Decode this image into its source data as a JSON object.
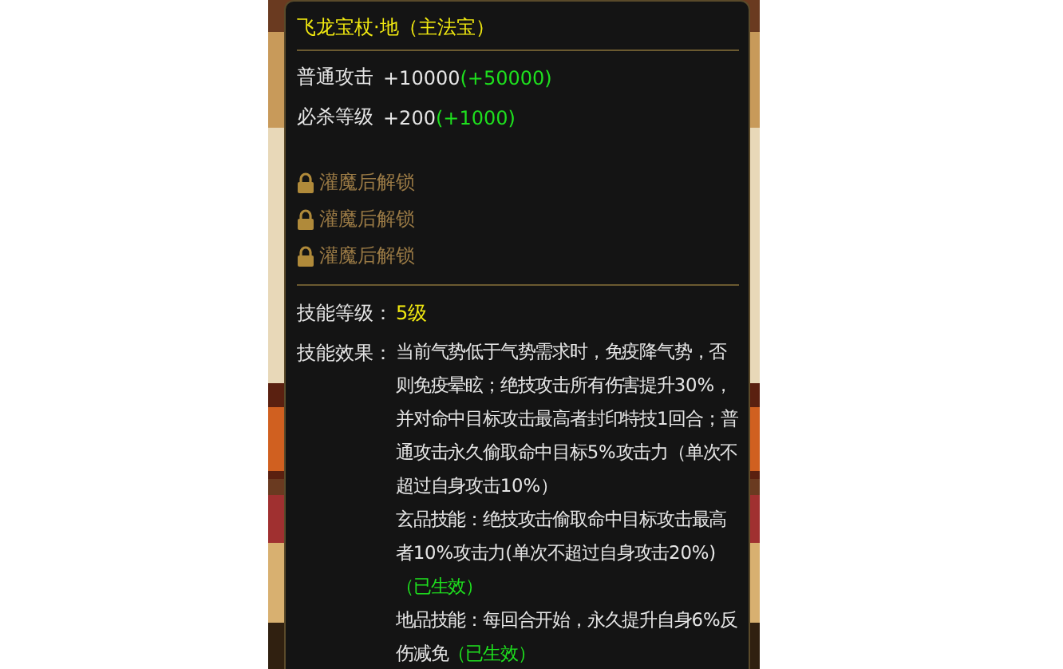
{
  "tooltip": {
    "title": "飞龙宝杖·地（主法宝）",
    "stats": [
      {
        "label": "普通攻击",
        "value": "+10000",
        "bonus": "(+50000)"
      },
      {
        "label": "必杀等级",
        "value": "+200",
        "bonus": "(+1000)"
      }
    ],
    "locked_slots": [
      {
        "text": "灌魔后解锁"
      },
      {
        "text": "灌魔后解锁"
      },
      {
        "text": "灌魔后解锁"
      }
    ],
    "skill_level": {
      "label": "技能等级：",
      "value": "5级"
    },
    "skill_effect": {
      "label": "技能效果：",
      "paragraphs": [
        {
          "text": "当前气势低于气势需求时，免疫降气势，否则免疫晕眩；绝技攻击所有伤害提升30%，并对命中目标攻击最高者封印特技1回合；普通攻击永久偷取命中目标5%攻击力（单次不超过自身攻击10%）"
        },
        {
          "text": "玄品技能：绝技攻击偷取命中目标攻击最高者10%攻击力(单次不超过自身攻击20%)",
          "status": "（已生效）"
        },
        {
          "text": "地品技能：每回合开始，永久提升自身6%反伤减免",
          "status": "（已生效）"
        }
      ]
    }
  }
}
